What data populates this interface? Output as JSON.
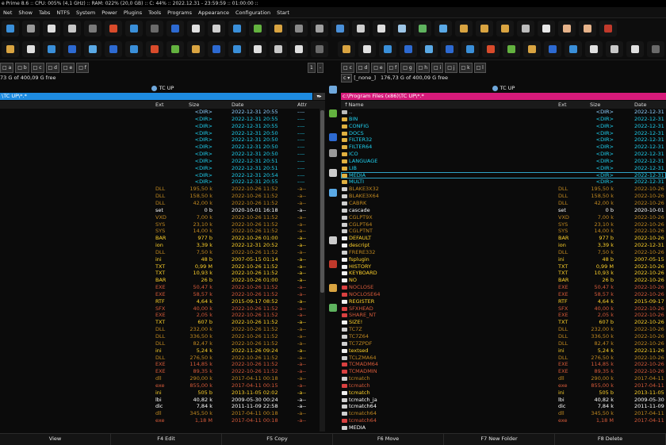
{
  "titlebar": "e Prime 8.6 :: CPU: 005% (4,1 GHz) :: RAM: 022% (20,0 GB) :: C: 44% :: 2022.12.31 - 23:59:59 :: 01:00:00 ::",
  "menu": [
    "Net",
    "Show",
    "Tabs",
    "NTFS",
    "System",
    "Power",
    "Plugins",
    "Tools",
    "Programs",
    "Appearance",
    "Configuration",
    "Start"
  ],
  "colors": {
    "accent_left": "#1e8be0",
    "accent_right": "#d61a7a"
  },
  "left": {
    "drives": [
      "□ a",
      "□ b",
      "□ c",
      "□ d",
      "□ e",
      "□ f"
    ],
    "free": "73 G of 400,09 G free",
    "up_label": "TC UP",
    "path": "\\TC UP\\*.*",
    "cols": {
      "ext": "Ext",
      "size": "Size",
      "date": "Date",
      "attr": "Attr"
    }
  },
  "right": {
    "drives": [
      "□ c",
      "□ d",
      "□ e",
      "□ f",
      "□ g",
      "□ h",
      "□ i",
      "□ j",
      "□ k",
      "□ l"
    ],
    "drive_select": "c",
    "drive_label": "[_none_]",
    "free": "176,73 G of 400,09 G free",
    "up_label": "TC UP",
    "path": "c:\\Program Files (x86)\\TC UP\\*.*",
    "cols": {
      "name": "↑Name",
      "ext": "Ext",
      "size": "Size",
      "date": "Date"
    }
  },
  "files": [
    {
      "n": "..",
      "e": "",
      "s": "<DIR>",
      "d": "2022-12-31 20:55",
      "a": "----",
      "t": "up"
    },
    {
      "n": "BIN",
      "e": "",
      "s": "<DIR>",
      "d": "2022-12-31 20:55",
      "a": "----",
      "t": "dir"
    },
    {
      "n": "CONFIG",
      "e": "",
      "s": "<DIR>",
      "d": "2022-12-31 20:55",
      "a": "----",
      "t": "dir"
    },
    {
      "n": "DOCS",
      "e": "",
      "s": "<DIR>",
      "d": "2022-12-31 20:50",
      "a": "----",
      "t": "dir"
    },
    {
      "n": "FILTER32",
      "e": "",
      "s": "<DIR>",
      "d": "2022-12-31 20:50",
      "a": "----",
      "t": "dir"
    },
    {
      "n": "FILTER64",
      "e": "",
      "s": "<DIR>",
      "d": "2022-12-31 20:50",
      "a": "----",
      "t": "dir"
    },
    {
      "n": "ICO",
      "e": "",
      "s": "<DIR>",
      "d": "2022-12-31 20:50",
      "a": "----",
      "t": "dir"
    },
    {
      "n": "LANGUAGE",
      "e": "",
      "s": "<DIR>",
      "d": "2022-12-31 20:51",
      "a": "----",
      "t": "dir"
    },
    {
      "n": "LIB",
      "e": "",
      "s": "<DIR>",
      "d": "2022-12-31 20:51",
      "a": "----",
      "t": "dir"
    },
    {
      "n": "MEDIA",
      "e": "",
      "s": "<DIR>",
      "d": "2022-12-31 20:54",
      "a": "----",
      "t": "dir"
    },
    {
      "n": "MULTI",
      "e": "",
      "s": "<DIR>",
      "d": "2022-12-31 20:55",
      "a": "----",
      "t": "dir"
    },
    {
      "n": "BLAKE3X32",
      "e": "DLL",
      "s": "195,50 k",
      "d": "2022-10-26 11:52",
      "a": "-a--",
      "t": "dll"
    },
    {
      "n": "BLAKE3X64",
      "e": "DLL",
      "s": "158,50 k",
      "d": "2022-10-26 11:52",
      "a": "-a--",
      "t": "dll"
    },
    {
      "n": "CABRK",
      "e": "DLL",
      "s": "42,00 k",
      "d": "2022-10-26 11:52",
      "a": "-a--",
      "t": "dll"
    },
    {
      "n": "cascade",
      "e": "set",
      "s": "0 b",
      "d": "2020-10-01 16:18",
      "a": "-a--",
      "t": "set"
    },
    {
      "n": "CGLPT9X",
      "e": "VXD",
      "s": "7,00 k",
      "d": "2022-10-26 11:52",
      "a": "-a--",
      "t": "dll"
    },
    {
      "n": "CGLPT64",
      "e": "SYS",
      "s": "23,10 k",
      "d": "2022-10-26 11:52",
      "a": "-a--",
      "t": "dll"
    },
    {
      "n": "CGLPTNT",
      "e": "SYS",
      "s": "14,00 k",
      "d": "2022-10-26 11:52",
      "a": "-a--",
      "t": "dll"
    },
    {
      "n": "DEFAULT",
      "e": "BAR",
      "s": "977 b",
      "d": "2022-10-26 01:00",
      "a": "-a--",
      "t": "txt"
    },
    {
      "n": "descript",
      "e": "ion",
      "s": "3,39 k",
      "d": "2022-12-31 20:52",
      "a": "-a--",
      "t": "txt"
    },
    {
      "n": "FRERE332",
      "e": "DLL",
      "s": "7,50 k",
      "d": "2022-10-26 11:52",
      "a": "-a--",
      "t": "dll"
    },
    {
      "n": "fsplugin",
      "e": "ini",
      "s": "48 b",
      "d": "2007-05-15 01:14",
      "a": "-a--",
      "t": "txt"
    },
    {
      "n": "HISTORY",
      "e": "TXT",
      "s": "0,99 M",
      "d": "2022-10-26 11:52",
      "a": "-a--",
      "t": "txt"
    },
    {
      "n": "KEYBOARD",
      "e": "TXT",
      "s": "10,93 k",
      "d": "2022-10-26 11:52",
      "a": "-a--",
      "t": "txt"
    },
    {
      "n": "NO",
      "e": "BAR",
      "s": "26 b",
      "d": "2022-10-26 01:00",
      "a": "-a--",
      "t": "txt"
    },
    {
      "n": "NOCLOSE",
      "e": "EXE",
      "s": "50,47 k",
      "d": "2022-10-26 11:52",
      "a": "-a--",
      "t": "exe"
    },
    {
      "n": "NOCLOSE64",
      "e": "EXE",
      "s": "58,57 k",
      "d": "2022-10-26 11:52",
      "a": "-a--",
      "t": "exe"
    },
    {
      "n": "REGISTER",
      "e": "RTF",
      "s": "4,64 k",
      "d": "2015-09-17 08:52",
      "a": "-a--",
      "t": "txt"
    },
    {
      "n": "SFXHEAD",
      "e": "SFX",
      "s": "40,00 k",
      "d": "2022-10-26 11:52",
      "a": "-a--",
      "t": "exe"
    },
    {
      "n": "SHARE_NT",
      "e": "EXE",
      "s": "2,05 k",
      "d": "2022-10-26 11:52",
      "a": "-a--",
      "t": "exe"
    },
    {
      "n": "SIZE!",
      "e": "TXT",
      "s": "607 b",
      "d": "2022-10-26 11:52",
      "a": "-a--",
      "t": "txt"
    },
    {
      "n": "TC7Z",
      "e": "DLL",
      "s": "232,00 k",
      "d": "2022-10-26 11:52",
      "a": "-a--",
      "t": "dll"
    },
    {
      "n": "TC7Z64",
      "e": "DLL",
      "s": "336,50 k",
      "d": "2022-10-26 11:52",
      "a": "-a--",
      "t": "dll"
    },
    {
      "n": "TC7ZPDF",
      "e": "DLL",
      "s": "82,47 k",
      "d": "2022-10-26 11:52",
      "a": "-a--",
      "t": "dll"
    },
    {
      "n": "textsed",
      "e": "ini",
      "s": "5,24 k",
      "d": "2022-11-26 09:24",
      "a": "-a--",
      "t": "txt"
    },
    {
      "n": "TCLZMA64",
      "e": "DLL",
      "s": "276,50 k",
      "d": "2022-10-26 11:52",
      "a": "-a--",
      "t": "dll"
    },
    {
      "n": "TCMADM64",
      "e": "EXE",
      "s": "114,85 k",
      "d": "2022-10-26 11:52",
      "a": "-a--",
      "t": "exe"
    },
    {
      "n": "TCMADMIN",
      "e": "EXE",
      "s": "89,35 k",
      "d": "2022-10-26 11:52",
      "a": "-a--",
      "t": "exe"
    },
    {
      "n": "tcmatch",
      "e": "dll",
      "s": "290,00 k",
      "d": "2017-04-11 00:18",
      "a": "-a--",
      "t": "dll"
    },
    {
      "n": "tcmatch",
      "e": "exe",
      "s": "855,00 k",
      "d": "2017-04-11 00:15",
      "a": "-a--",
      "t": "exe"
    },
    {
      "n": "tcmatch",
      "e": "ini",
      "s": "505 b",
      "d": "2013-11-05 02:02",
      "a": "-a--",
      "t": "txt"
    },
    {
      "n": "tcmatch_ja",
      "e": "lbi",
      "s": "40,82 k",
      "d": "2009-05-30 00:24",
      "a": "-a--",
      "t": "set"
    },
    {
      "n": "tcmatch64",
      "e": "dic",
      "s": "7,84 k",
      "d": "2011-11-09 22:58",
      "a": "-a--",
      "t": "set"
    },
    {
      "n": "tcmatch64",
      "e": "dll",
      "s": "345,50 k",
      "d": "2017-04-11 00:18",
      "a": "-a--",
      "t": "dll"
    },
    {
      "n": "tcmatch64",
      "e": "exe",
      "s": "1,18 M",
      "d": "2017-04-11 00:18",
      "a": "-a--",
      "t": "exe"
    },
    {
      "n": "MEDIA",
      "e": "",
      "s": "",
      "d": "",
      "a": "",
      "t": "plain"
    }
  ],
  "fnkeys": [
    "View",
    "F4 Edit",
    "F5 Copy",
    "F6 Move",
    "F7 New Folder",
    "F8 Delete"
  ]
}
